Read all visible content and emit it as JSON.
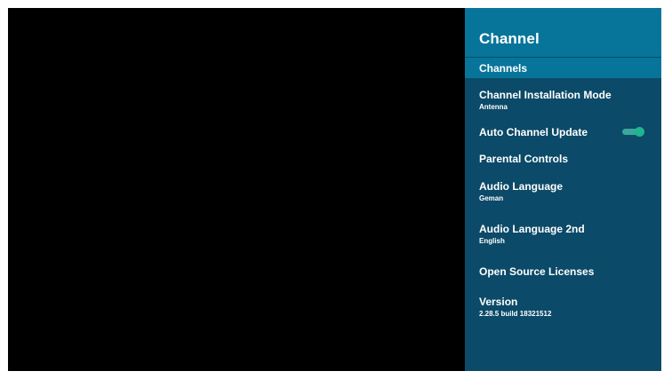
{
  "panel": {
    "title": "Channel",
    "items": [
      {
        "label": "Channels",
        "selected": true
      },
      {
        "label": "Channel Installation Mode",
        "sub": "Antenna"
      },
      {
        "label": "Auto Channel Update",
        "toggle": true
      },
      {
        "label": "Parental Controls"
      },
      {
        "label": "Audio Language",
        "sub": "Geman"
      },
      {
        "label": "Audio Language 2nd",
        "sub": "English"
      },
      {
        "label": "Open Source Licenses"
      },
      {
        "label": "Version",
        "sub": "2.28.5 build 18321512"
      }
    ]
  },
  "colors": {
    "header": "#07759a",
    "panel": "#0b4a68",
    "toggle_on": "#1fb58f"
  }
}
